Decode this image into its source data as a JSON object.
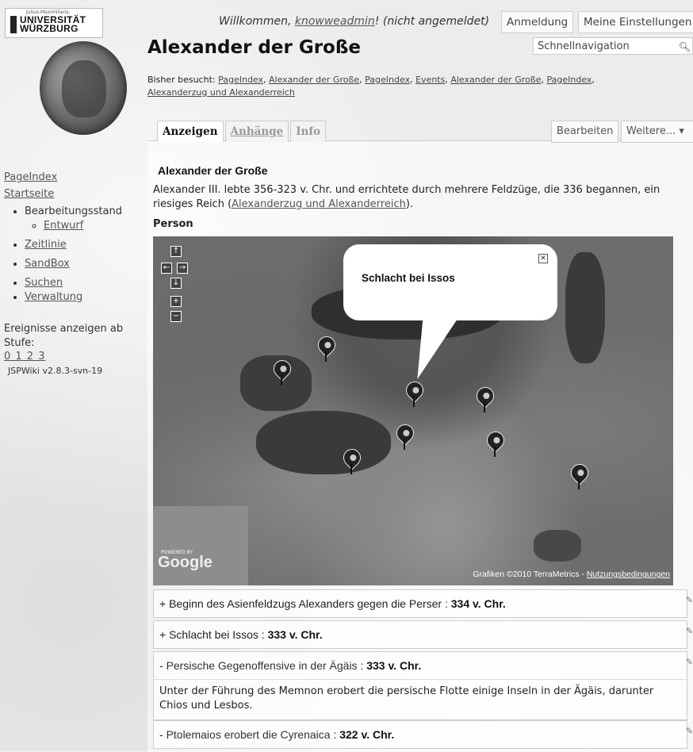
{
  "logo": {
    "small": "Julius-Maximilians-",
    "line1": "UNIVERSITÄT",
    "line2": "WÜRZBURG"
  },
  "header": {
    "welcome_prefix": "Willkommen, ",
    "username": "knowweadmin",
    "welcome_suffix": "! (nicht angemeldet)",
    "login": "Anmeldung",
    "settings": "Meine Einstellungen"
  },
  "page_title": "Alexander der Große",
  "search": {
    "placeholder": "Schnellnavigation"
  },
  "visited": {
    "label": "Bisher besucht: ",
    "items": [
      "PageIndex",
      "Alexander der Große",
      "PageIndex",
      "Events",
      "Alexander der Große",
      "PageIndex",
      "Alexanderzug und Alexanderreich"
    ]
  },
  "tabs": {
    "view": "Anzeigen",
    "attachments": "Anhänge",
    "info": "Info"
  },
  "actions": {
    "edit": "Bearbeiten",
    "more": "Weitere... ▾"
  },
  "sidebar": {
    "pageindex": "PageIndex",
    "home": "Startseite",
    "status": "Bearbeitungsstand",
    "draft": "Entwurf",
    "timeline": "Zeitlinie",
    "sandbox": "SandBox",
    "search": "Suchen",
    "admin": "Verwaltung",
    "events_label": "Ereignisse anzeigen ab Stufe:",
    "levels": "0 1 2 3",
    "version": "JSPWiki v2.8.3-svn-19"
  },
  "article": {
    "heading": "Alexander der Große",
    "intro_text": "Alexander III. lebte 356-323 v. Chr. und errichtete durch mehrere Feldzüge, die 336 begannen, ein riesiges Reich (",
    "intro_link": "Alexanderzug und Alexanderreich",
    "intro_end": ").",
    "person_label": "Person"
  },
  "map": {
    "popup": "Schlacht bei Issos",
    "powered": "POWERED BY",
    "google": "Google",
    "credit": "Grafiken ©2010 TerraMetrics - ",
    "terms": "Nutzungsbedingungen"
  },
  "events": [
    {
      "marker": "+",
      "name": "Beginn des Asienfeldzugs Alexanders gegen die Perser",
      "date": "334 v. Chr.",
      "open": false,
      "body": ""
    },
    {
      "marker": "+",
      "name": "Schlacht bei Issos",
      "date": "333 v. Chr.",
      "open": false,
      "body": ""
    },
    {
      "marker": "-",
      "name": "Persische Gegenoffensive in der Ägäis",
      "date": "333 v. Chr.",
      "open": true,
      "body": "Unter der Führung des Memnon erobert die persische Flotte einige Inseln in der Ägäis, darunter Chios und Lesbos."
    },
    {
      "marker": "-",
      "name": "Ptolemaios erobert die Cyrenaica",
      "date": "322 v. Chr.",
      "open": true,
      "body": ""
    }
  ]
}
